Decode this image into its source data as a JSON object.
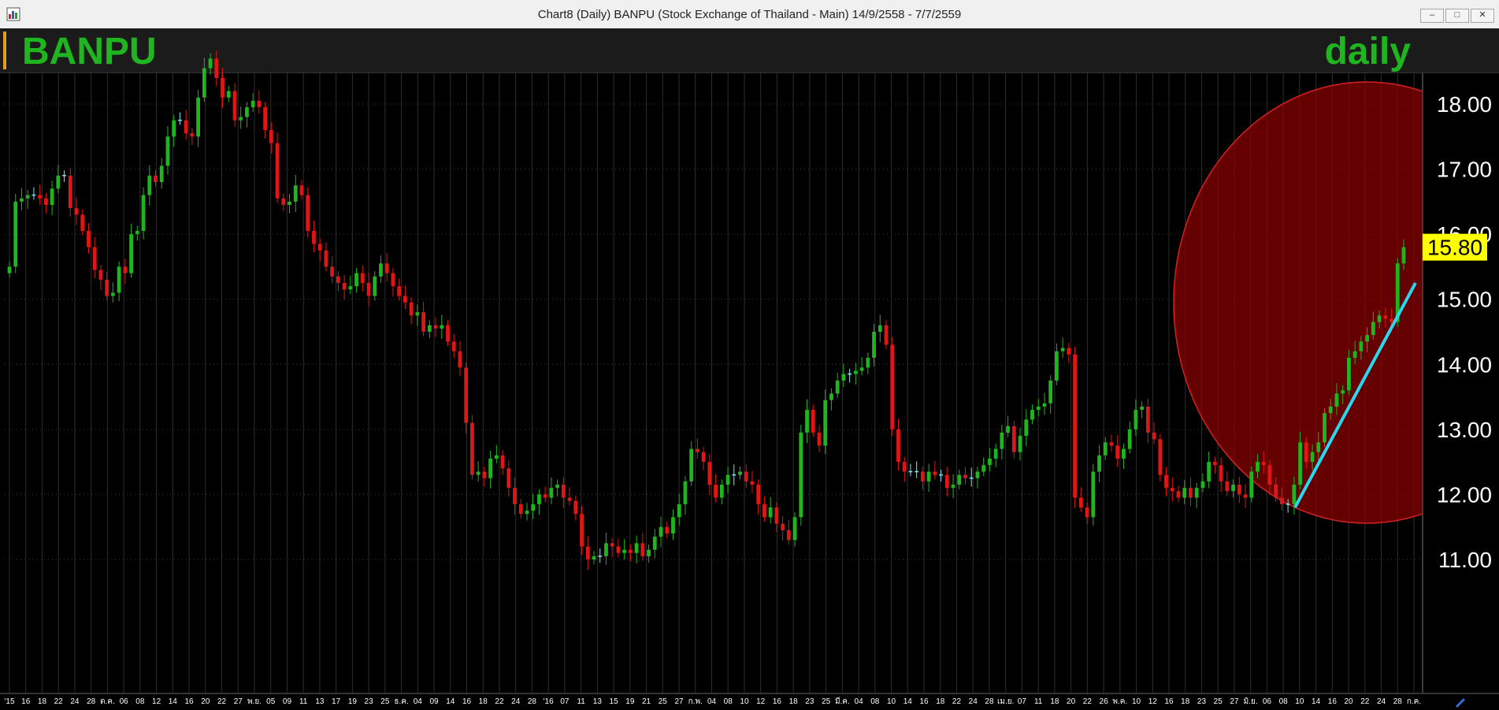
{
  "window": {
    "title": "Chart8 (Daily)  BANPU (Stock Exchange of Thailand - Main) 14/9/2558 - 7/7/2559",
    "buttons": [
      "minimize",
      "restore",
      "close"
    ]
  },
  "header": {
    "symbol": "BANPU",
    "period": "daily"
  },
  "colors": {
    "up": "#1fb51f",
    "down": "#e01616",
    "doji": "#7fe7f5",
    "trendline": "#2ad7ee",
    "highlight": "#8b0000",
    "last_price_bg": "#ffff00",
    "symbol_text": "#1fb51f"
  },
  "chart_data": {
    "type": "candlestick",
    "y_ticks": [
      "18.00",
      "17.00",
      "16.00",
      "15.00",
      "14.00",
      "13.00",
      "12.00",
      "11.00"
    ],
    "ylim": [
      10.9,
      18.6
    ],
    "last_price": "15.80",
    "x_tick_labels": [
      "'15",
      "16",
      "18",
      "22",
      "24",
      "28",
      "ต.ค.",
      "06",
      "08",
      "12",
      "14",
      "16",
      "20",
      "22",
      "27",
      "พ.ย.",
      "05",
      "09",
      "11",
      "13",
      "17",
      "19",
      "23",
      "25",
      "ธ.ค.",
      "04",
      "09",
      "14",
      "16",
      "18",
      "22",
      "24",
      "28",
      "'16",
      "07",
      "11",
      "13",
      "15",
      "19",
      "21",
      "25",
      "27",
      "ก.พ.",
      "04",
      "08",
      "10",
      "12",
      "16",
      "18",
      "23",
      "25",
      "มี.ค.",
      "04",
      "08",
      "10",
      "14",
      "16",
      "18",
      "22",
      "24",
      "28",
      "เม.ย.",
      "07",
      "11",
      "18",
      "20",
      "22",
      "26",
      "พ.ค.",
      "10",
      "12",
      "16",
      "18",
      "23",
      "25",
      "27",
      "มิ.ย.",
      "06",
      "08",
      "10",
      "14",
      "16",
      "20",
      "22",
      "24",
      "28",
      "ก.ค."
    ],
    "series_closes": [
      15.5,
      16.5,
      16.55,
      16.6,
      16.6,
      16.55,
      16.45,
      16.7,
      16.9,
      16.9,
      16.4,
      16.3,
      16.05,
      15.8,
      15.45,
      15.3,
      15.05,
      15.1,
      15.5,
      15.4,
      16.0,
      16.05,
      16.6,
      16.9,
      16.8,
      17.05,
      17.5,
      17.75,
      17.75,
      17.55,
      17.5,
      18.1,
      18.55,
      18.7,
      18.4,
      18.1,
      18.2,
      17.75,
      17.8,
      17.95,
      18.05,
      17.95,
      17.6,
      17.4,
      16.55,
      16.45,
      16.5,
      16.75,
      16.6,
      16.05,
      15.85,
      15.75,
      15.5,
      15.35,
      15.25,
      15.15,
      15.2,
      15.4,
      15.25,
      15.05,
      15.35,
      15.55,
      15.4,
      15.2,
      15.05,
      14.95,
      14.75,
      14.8,
      14.5,
      14.6,
      14.55,
      14.6,
      14.35,
      14.2,
      13.95,
      13.1,
      12.3,
      12.35,
      12.25,
      12.55,
      12.6,
      12.4,
      12.1,
      11.85,
      11.7,
      11.75,
      11.85,
      12.0,
      11.95,
      12.1,
      12.15,
      11.95,
      11.9,
      11.7,
      11.2,
      11.0,
      11.05,
      11.05,
      11.25,
      11.2,
      11.1,
      11.15,
      11.1,
      11.25,
      11.05,
      11.15,
      11.35,
      11.5,
      11.4,
      11.65,
      11.85,
      12.2,
      12.7,
      12.65,
      12.5,
      12.15,
      11.95,
      12.15,
      12.3,
      12.3,
      12.35,
      12.2,
      12.15,
      11.85,
      11.65,
      11.8,
      11.55,
      11.45,
      11.3,
      11.65,
      12.95,
      13.3,
      12.95,
      12.75,
      13.45,
      13.55,
      13.75,
      13.85,
      13.85,
      13.9,
      13.95,
      14.1,
      14.5,
      14.6,
      14.3,
      13.0,
      12.5,
      12.35,
      12.35,
      12.35,
      12.2,
      12.35,
      12.3,
      12.3,
      12.1,
      12.15,
      12.3,
      12.25,
      12.25,
      12.35,
      12.45,
      12.55,
      12.7,
      12.95,
      13.05,
      12.65,
      12.9,
      13.15,
      13.3,
      13.35,
      13.4,
      13.75,
      14.2,
      14.25,
      14.15,
      11.95,
      11.8,
      11.65,
      12.35,
      12.6,
      12.8,
      12.75,
      12.55,
      12.7,
      13.0,
      13.3,
      13.35,
      12.95,
      12.85,
      12.3,
      12.1,
      12.05,
      11.95,
      12.1,
      11.95,
      12.1,
      12.2,
      12.5,
      12.45,
      12.2,
      12.05,
      12.15,
      12.0,
      11.95,
      12.35,
      12.5,
      12.45,
      12.15,
      11.95,
      11.85,
      11.85,
      12.15,
      12.8,
      12.5,
      12.65,
      12.8,
      13.25,
      13.35,
      13.55,
      13.6,
      14.1,
      14.2,
      14.35,
      14.45,
      14.65,
      14.75,
      14.7,
      14.65,
      15.55,
      15.8
    ]
  }
}
